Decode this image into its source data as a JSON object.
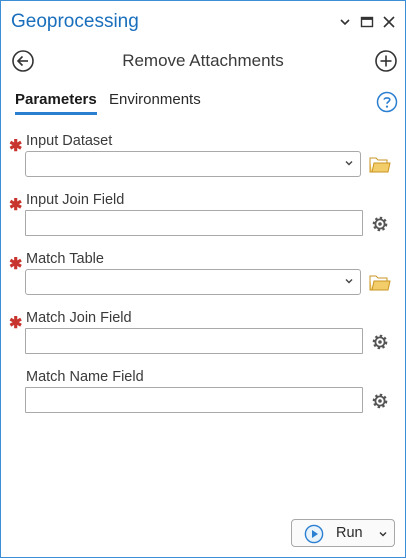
{
  "pane": {
    "title": "Geoprocessing"
  },
  "tool": {
    "title": "Remove Attachments"
  },
  "tabs": [
    {
      "label": "Parameters",
      "active": true
    },
    {
      "label": "Environments",
      "active": false
    }
  ],
  "params": [
    {
      "label": "Input Dataset",
      "required": true,
      "type": "dropdown",
      "value": "",
      "action_icon": "folder-icon"
    },
    {
      "label": "Input Join Field",
      "required": true,
      "type": "text",
      "value": "",
      "action_icon": "gear-icon"
    },
    {
      "label": "Match Table",
      "required": true,
      "type": "dropdown",
      "value": "",
      "action_icon": "folder-icon"
    },
    {
      "label": "Match Join Field",
      "required": true,
      "type": "text",
      "value": "",
      "action_icon": "gear-icon"
    },
    {
      "label": "Match Name Field",
      "required": false,
      "type": "text",
      "value": "",
      "action_icon": "gear-icon"
    }
  ],
  "run": {
    "label": "Run"
  },
  "colors": {
    "accent": "#2b7fd1",
    "required": "#c8352e",
    "folder": "#e8b84a",
    "title": "#1a6fbd"
  }
}
